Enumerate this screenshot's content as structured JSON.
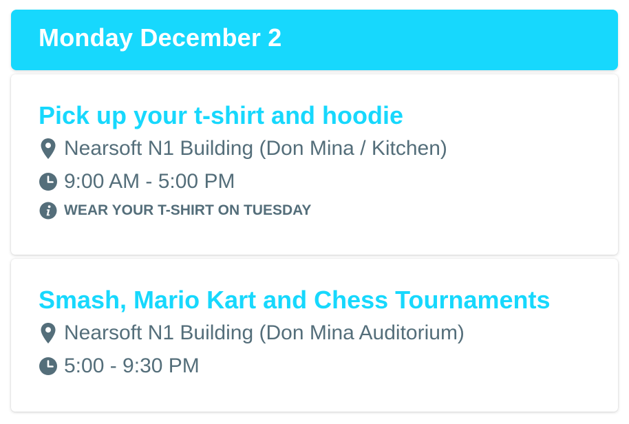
{
  "day": {
    "title": "Monday December 2",
    "color": "#17d8fd"
  },
  "events": [
    {
      "title": "Pick up your t-shirt and hoodie",
      "location": "Nearsoft N1 Building (Don Mina / Kitchen)",
      "time": "9:00 AM - 5:00 PM",
      "note": "WEAR YOUR T-SHIRT ON TUESDAY",
      "icons": {
        "location": "map-pin-icon",
        "time": "clock-icon",
        "note": "info-icon"
      }
    },
    {
      "title": "Smash, Mario Kart and Chess Tournaments",
      "location": "Nearsoft N1 Building (Don Mina Auditorium)",
      "time": "5:00 - 9:30 PM",
      "icons": {
        "location": "map-pin-icon",
        "time": "clock-icon"
      }
    }
  ],
  "colors": {
    "accent": "#17d8fd",
    "text": "#546e7a",
    "card_background": "#ffffff"
  }
}
